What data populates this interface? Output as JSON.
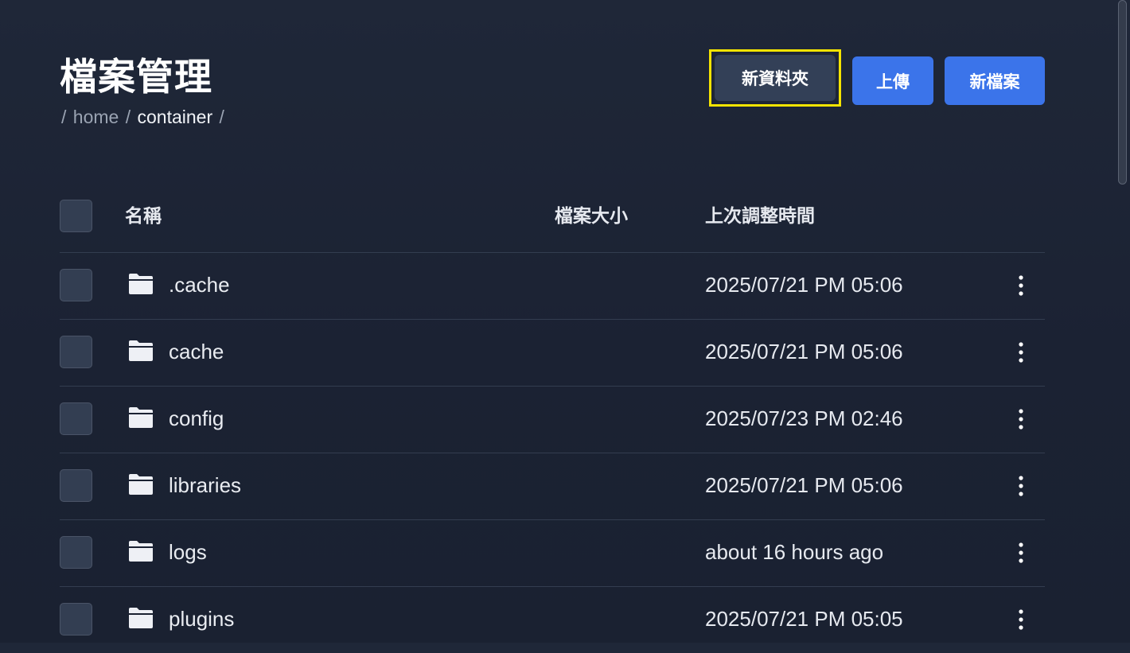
{
  "header": {
    "title": "檔案管理",
    "breadcrumb": {
      "sep": "/",
      "items": [
        "home",
        "container"
      ]
    }
  },
  "actions": {
    "new_folder": "新資料夾",
    "upload": "上傳",
    "new_file": "新檔案"
  },
  "table": {
    "columns": {
      "name": "名稱",
      "size": "檔案大小",
      "modified": "上次調整時間"
    },
    "rows": [
      {
        "name": ".cache",
        "size": "",
        "modified": "2025/07/21 PM 05:06"
      },
      {
        "name": "cache",
        "size": "",
        "modified": "2025/07/21 PM 05:06"
      },
      {
        "name": "config",
        "size": "",
        "modified": "2025/07/23 PM 02:46"
      },
      {
        "name": "libraries",
        "size": "",
        "modified": "2025/07/21 PM 05:06"
      },
      {
        "name": "logs",
        "size": "",
        "modified": "about 16 hours ago"
      },
      {
        "name": "plugins",
        "size": "",
        "modified": "2025/07/21 PM 05:05"
      }
    ]
  },
  "icons": {
    "row_icon": "folder-icon",
    "row_menu": "more-vertical-icon"
  },
  "colors": {
    "primary": "#3b74ea",
    "secondary": "#334057",
    "highlight": "#f5e400",
    "folder": "#eef0f5"
  }
}
